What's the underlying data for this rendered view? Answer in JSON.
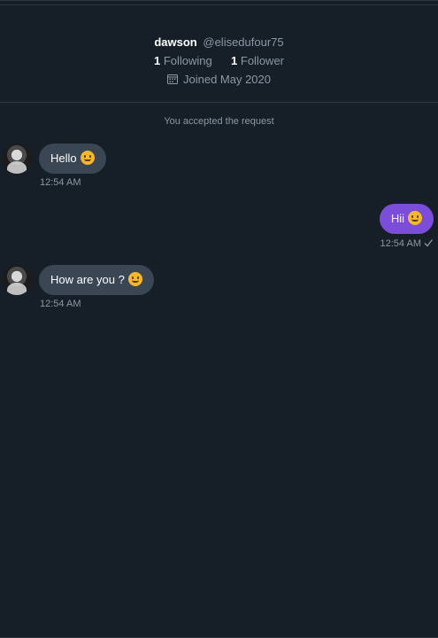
{
  "profile": {
    "name": "dawson",
    "handle": "@elisedufour75",
    "following_count": "1",
    "following_label": "Following",
    "follower_count": "1",
    "follower_label": "Follower",
    "joined": "Joined May 2020",
    "joined_icon": "calendar-icon"
  },
  "system_note": "You accepted the request",
  "messages": [
    {
      "direction": "in",
      "text": "Hello",
      "emoji": "hugging-face-emoji",
      "time": "12:54 AM"
    },
    {
      "direction": "out",
      "text": "Hii",
      "emoji": "kissing-face-emoji",
      "time": "12:54 AM",
      "status_icon": "check-icon"
    },
    {
      "direction": "in",
      "text": "How are you ?",
      "emoji": "smiling-face-emoji",
      "time": "12:54 AM"
    }
  ],
  "colors": {
    "background": "#161f28",
    "incoming_bubble": "#3a4654",
    "outgoing_bubble": "#7c4dd8",
    "muted_text": "#8b98a5"
  }
}
